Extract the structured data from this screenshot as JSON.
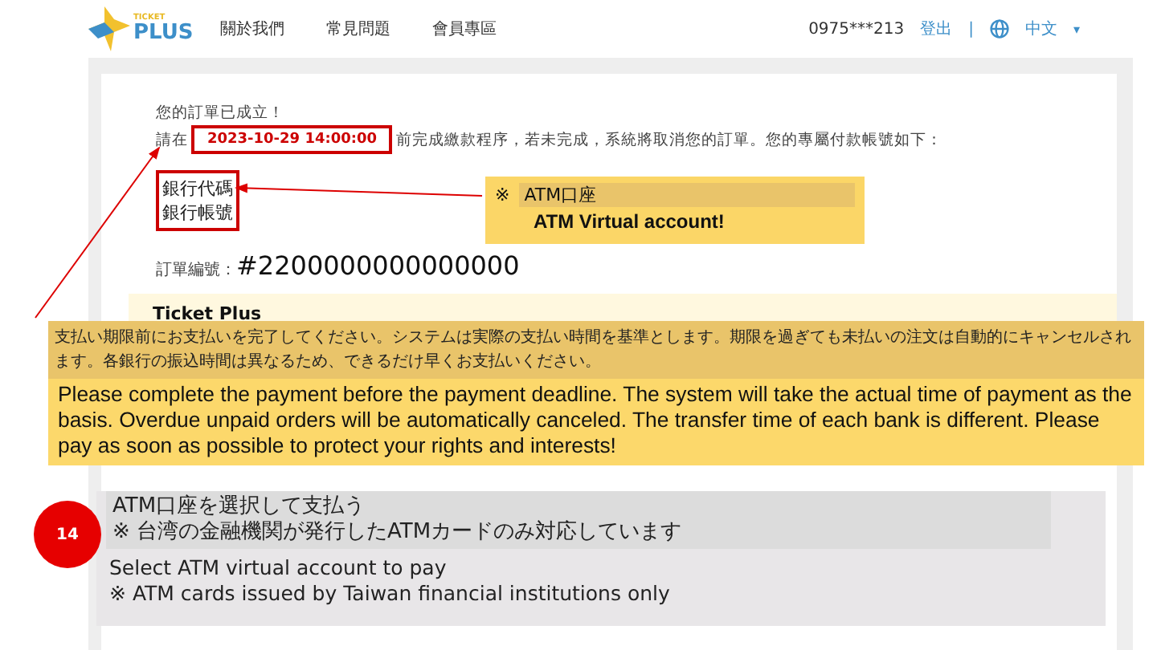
{
  "header": {
    "logo_small": "TICKET",
    "logo": "PLUS",
    "nav": [
      "關於我們",
      "常見問題",
      "會員專區"
    ],
    "phone": "0975***213",
    "logout": "登出",
    "separator": "|",
    "language": "中文",
    "caret": "▾"
  },
  "order": {
    "title": "您的訂單已成立！",
    "before": "請在",
    "deadline": "2023-10-29 14:00:00",
    "after": "前完成繳款程序，若未完成，系統將取消您的訂單。您的專屬付款帳號如下：",
    "bank_code": "銀行代碼",
    "bank_account": "銀行帳號",
    "order_label": "訂單編號：",
    "order_number": "#2200000000000000",
    "merchant": "Ticket Plus"
  },
  "callout": {
    "mark": "※",
    "title": "ATM口座",
    "subtitle": "ATM Virtual account!"
  },
  "notice": {
    "japanese": "支払い期限前にお支払いを完了してください。システムは実際の支払い時間を基準とします。期限を過ぎても未払いの注文は自動的にキャンセルされます。各銀行の振込時間は異なるため、できるだけ早くお支払いください。",
    "english": "Please complete the payment before the payment deadline. The system will take the actual time of payment as the basis. Overdue unpaid orders will be automatically canceled. The transfer time of each bank is different. Please pay as soon as possible to protect your rights and interests!"
  },
  "step": {
    "number": "14",
    "japanese": [
      "ATM口座を選択して支払う",
      "※ 台湾の金融機関が発行したATMカードのみ対応しています"
    ],
    "english": [
      "Select ATM virtual account to pay",
      "※ ATM cards issued by Taiwan financial institutions only"
    ]
  }
}
